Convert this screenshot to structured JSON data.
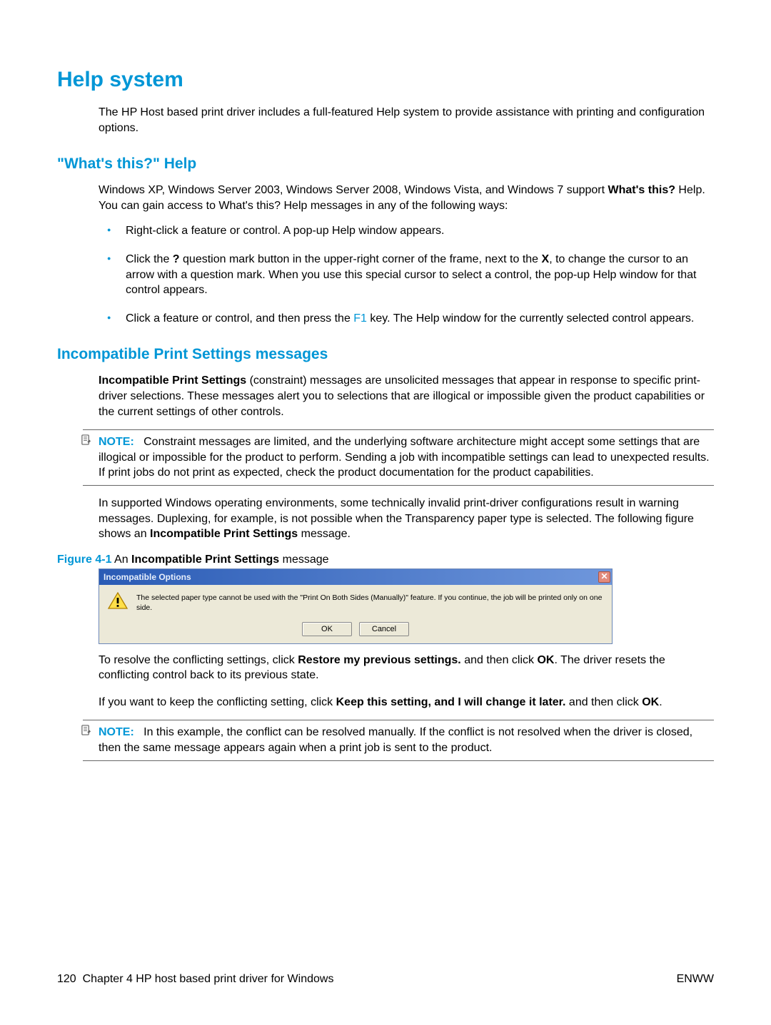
{
  "h1": "Help system",
  "intro": "The HP Host based print driver includes a full-featured Help system to provide assistance with printing and configuration options.",
  "whats_this": {
    "heading": "\"What's this?\" Help",
    "para_pre": "Windows XP, Windows Server 2003, Windows Server 2008, Windows Vista, and Windows 7 support ",
    "para_bold": "What's this?",
    "para_post": " Help. You can gain access to What's this? Help messages in any of the following ways:",
    "bullets": {
      "b1": "Right-click a feature or control. A pop-up Help window appears.",
      "b2_pre": "Click the ",
      "b2_q": "?",
      "b2_mid1": " question mark button in the upper-right corner of the frame, next to the ",
      "b2_x": "X",
      "b2_post": ", to change the cursor to an arrow with a question mark. When you use this special cursor to select a control, the pop-up Help window for that control appears.",
      "b3_pre": "Click a feature or control, and then press the ",
      "b3_key": "F1",
      "b3_post": " key. The Help window for the currently selected control appears."
    }
  },
  "incompat": {
    "heading": "Incompatible Print Settings messages",
    "p1_bold": "Incompatible Print Settings",
    "p1_post": " (constraint) messages are unsolicited messages that appear in response to specific print-driver selections. These messages alert you to selections that are illogical or impossible given the product capabilities or the current settings of other controls.",
    "note1_label": "NOTE:",
    "note1_text": "Constraint messages are limited, and the underlying software architecture might accept some settings that are illogical or impossible for the product to perform. Sending a job with incompatible settings can lead to unexpected results. If print jobs do not print as expected, check the product documentation for the product capabilities.",
    "p2_pre": "In supported Windows operating environments, some technically invalid print-driver configurations result in warning messages. Duplexing, for example, is not possible when the Transparency paper type is selected. The following figure shows an ",
    "p2_bold": "Incompatible Print Settings",
    "p2_post": " message.",
    "fig_label": "Figure 4-1",
    "fig_caption_pre": "  An ",
    "fig_caption_bold": "Incompatible Print Settings",
    "fig_caption_post": " message",
    "dialog": {
      "title": "Incompatible Options",
      "close": "✕",
      "message": "The selected paper type cannot be used with the \"Print On Both Sides (Manually)\" feature. If you continue, the job will be printed only on one side.",
      "ok": "OK",
      "cancel": "Cancel"
    },
    "p3_pre": "To resolve the conflicting settings, click ",
    "p3_bold1": "Restore my previous settings.",
    "p3_mid": " and then click ",
    "p3_bold2": "OK",
    "p3_post": ". The driver resets the conflicting control back to its previous state.",
    "p4_pre": "If you want to keep the conflicting setting, click ",
    "p4_bold1": "Keep this setting, and I will change it later.",
    "p4_mid": " and then click ",
    "p4_bold2": "OK",
    "p4_post": ".",
    "note2_label": "NOTE:",
    "note2_text": "In this example, the conflict can be resolved manually. If the conflict is not resolved when the driver is closed, then the same message appears again when a print job is sent to the product."
  },
  "footer": {
    "page": "120",
    "chapter": "Chapter 4   HP host based print driver for Windows",
    "right": "ENWW"
  }
}
